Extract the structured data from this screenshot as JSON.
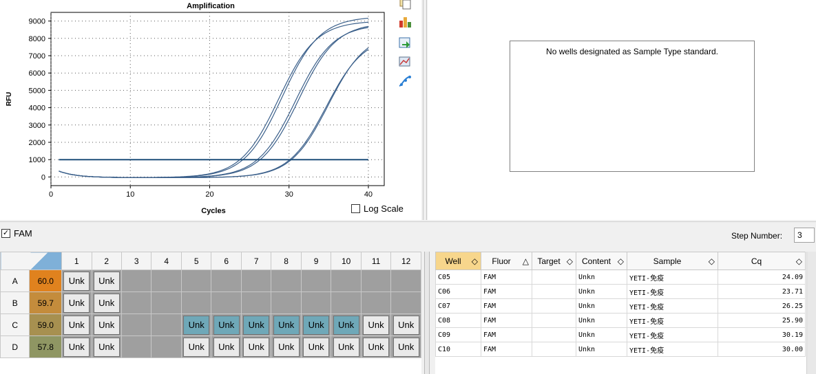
{
  "chart_panel": {
    "log_scale_label": "Log Scale",
    "log_scale_checked": false
  },
  "chart_data": {
    "type": "line",
    "title": "Amplification",
    "xlabel": "Cycles",
    "ylabel": "RFU",
    "xlim": [
      0,
      42
    ],
    "ylim": [
      -500,
      9500
    ],
    "xticks": [
      0,
      10,
      20,
      30,
      40
    ],
    "yticks": [
      0,
      1000,
      2000,
      3000,
      4000,
      5000,
      6000,
      7000,
      8000,
      9000
    ],
    "threshold": 1000,
    "series": [
      {
        "well": "C05",
        "cq": 24.09,
        "plateau": 9300
      },
      {
        "well": "C06",
        "cq": 23.71,
        "plateau": 9050
      },
      {
        "well": "C07",
        "cq": 26.25,
        "plateau": 8950
      },
      {
        "well": "C08",
        "cq": 25.9,
        "plateau": 8850
      },
      {
        "well": "C09",
        "cq": 30.19,
        "plateau": 8400
      },
      {
        "well": "C10",
        "cq": 30.0,
        "plateau": 8200
      }
    ],
    "line_color": "#3a5f8a",
    "threshold_color": "#1f4f7a"
  },
  "standard_panel": {
    "message": "No wells designated as Sample Type standard."
  },
  "fluor_bar": {
    "fluor_label": "FAM",
    "fluor_checked": true,
    "step_label": "Step Number:",
    "step_value": "3"
  },
  "plate": {
    "columns": [
      "1",
      "2",
      "3",
      "4",
      "5",
      "6",
      "7",
      "8",
      "9",
      "10",
      "11",
      "12"
    ],
    "rows": [
      {
        "label": "A",
        "temp": "60.0",
        "temp_color": "#e0821e",
        "wells": [
          "Unk",
          "Unk",
          "",
          "",
          "",
          "",
          "",
          "",
          "",
          "",
          "",
          ""
        ],
        "active": []
      },
      {
        "label": "B",
        "temp": "59.7",
        "temp_color": "#c48c3c",
        "wells": [
          "Unk",
          "Unk",
          "",
          "",
          "",
          "",
          "",
          "",
          "",
          "",
          "",
          ""
        ],
        "active": []
      },
      {
        "label": "C",
        "temp": "59.0",
        "temp_color": "#a79050",
        "wells": [
          "Unk",
          "Unk",
          "",
          "",
          "Unk",
          "Unk",
          "Unk",
          "Unk",
          "Unk",
          "Unk",
          "Unk",
          "Unk"
        ],
        "active": [
          4,
          5,
          6,
          7,
          8,
          9
        ]
      },
      {
        "label": "D",
        "temp": "57.8",
        "temp_color": "#8f9663",
        "wells": [
          "Unk",
          "Unk",
          "",
          "",
          "Unk",
          "Unk",
          "Unk",
          "Unk",
          "Unk",
          "Unk",
          "Unk",
          "Unk"
        ],
        "active": []
      }
    ]
  },
  "results": {
    "headers": [
      "Well",
      "Fluor",
      "Target",
      "Content",
      "Sample",
      "Cq"
    ],
    "sort_icons": [
      "◇",
      "△",
      "◇",
      "◇",
      "◇",
      "◇"
    ],
    "rows": [
      [
        "C05",
        "FAM",
        "",
        "Unkn",
        "YETI-免疫",
        "24.09"
      ],
      [
        "C06",
        "FAM",
        "",
        "Unkn",
        "YETI-免疫",
        "23.71"
      ],
      [
        "C07",
        "FAM",
        "",
        "Unkn",
        "YETI-免疫",
        "26.25"
      ],
      [
        "C08",
        "FAM",
        "",
        "Unkn",
        "YETI-免疫",
        "25.90"
      ],
      [
        "C09",
        "FAM",
        "",
        "Unkn",
        "YETI-免疫",
        "30.19"
      ],
      [
        "C10",
        "FAM",
        "",
        "Unkn",
        "YETI-免疫",
        "30.00"
      ]
    ]
  },
  "toolbar_icons": [
    "copy-icon",
    "chart-type-icon",
    "export-icon",
    "zoom-icon",
    "curve-icon"
  ]
}
